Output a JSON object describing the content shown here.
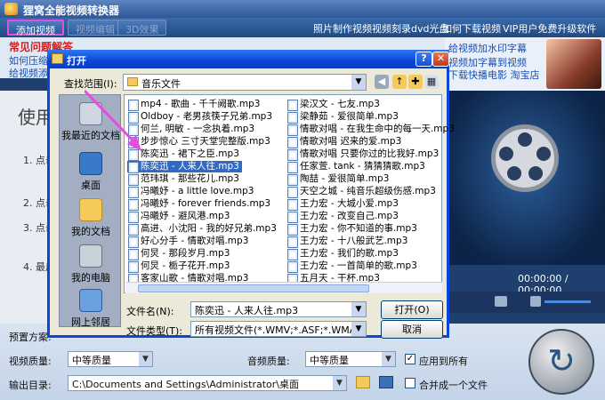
{
  "app": {
    "title": "狸窝全能视频转换器"
  },
  "toolbar": {
    "buttons": [
      "添加视频",
      "视频编辑",
      "3D效果"
    ],
    "links": [
      "照片制作视频",
      "视频刻录dvd光盘",
      "如何下载视频",
      "VIP用户免费升级软件"
    ]
  },
  "ads": {
    "red_title": "常见问题解答",
    "left_line1": "如何压缩",
    "left_line2": "给视频添",
    "right_line1": "给视频加水印字幕",
    "right_line2": "视频加字幕到视频",
    "right_line3": "下载快播电影  淘宝店"
  },
  "work": {
    "big_text": "使用",
    "steps": [
      "1. 点击",
      "2. 点击",
      "3. 点击",
      "4. 最后"
    ]
  },
  "player": {
    "time": "00:00:00 / 00:00:00"
  },
  "bottom": {
    "preset_label": "预置方案:",
    "video_quality_label": "视频质量:",
    "video_quality_value": "中等质量",
    "audio_quality_label": "音频质量:",
    "audio_quality_value": "中等质量",
    "apply_all_label": "应用到所有",
    "output_label": "输出目录:",
    "output_path": "C:\\Documents and Settings\\Administrator\\桌面",
    "merge_label": "合并成一个文件"
  },
  "dialog": {
    "title": "打开",
    "look_in_label": "查找范围(I):",
    "look_in_value": "音乐文件",
    "places": [
      "我最近的文档",
      "桌面",
      "我的文档",
      "我的电脑",
      "网上邻居"
    ],
    "files_col1": [
      "mp4 - 歌曲 - 千千阙歌.mp3",
      "Oldboy - 老男孩筷子兄弟.mp3",
      "何兰, 明敏 - 一念执着.mp3",
      "步步惊心 三寸天堂完整版.mp3",
      "陈奕迅 - 裙下之臣.mp3",
      "陈奕迅 - 人来人往.mp3",
      "范玮琪 - 那些花儿.mp3",
      "冯曦妤 - a little love.mp3",
      "冯曦妤 - forever friends.mp3",
      "冯曦妤 - 避风港.mp3",
      "高进、小沈阳 - 我的好兄弟.mp3",
      "好心分手 - 情歌对唱.mp3",
      "何炅 - 那段岁月.mp3",
      "何炅 - 栀子花开.mp3",
      "客家山歌 - 情歌对唱.mp3"
    ],
    "files_col2": [
      "梁汉文 - 七友.mp3",
      "梁静茹 - 爱很简单.mp3",
      "情歌对唱 - 在我生命中的每一天.mp3",
      "情歌对唱 迟来的爱.mp3",
      "情歌对唱 只要你过的比我好.mp3",
      "任家萱. tank - 猜猜猜歌.mp3",
      "陶喆 - 爱很简单.mp3",
      "天空之城 - 纯音乐超级伤感.mp3",
      "王力宏 - 大城小爱.mp3",
      "王力宏 - 改变自己.mp3",
      "王力宏 - 你不知道的事.mp3",
      "王力宏 - 十八般武艺.mp3",
      "王力宏 - 我们的歌.mp3",
      "王力宏 - 一首简单的歌.mp3",
      "五月天 - 干杯.mp3"
    ],
    "selected_index": 5,
    "filename_label": "文件名(N):",
    "filename_value": "陈奕迅 - 人来人往.mp3",
    "filetype_label": "文件类型(T):",
    "filetype_value": "所有视频文件(*.WMV;*.ASF;*.WMA;*.AVI;",
    "open_button": "打开(O)",
    "cancel_button": "取消"
  },
  "colors": {
    "selection": "#316ac5",
    "dialog_title": "#0a46d8",
    "annotation": "#e64ce0"
  }
}
